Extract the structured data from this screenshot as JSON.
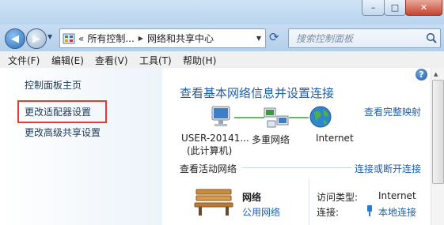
{
  "window": {
    "minimize": "–",
    "maximize": "□",
    "close": "✕"
  },
  "nav": {
    "back": "◀",
    "forward": "▶",
    "breadcrumb_prefix": "«",
    "breadcrumb_1": "所有控制...",
    "breadcrumb_sep": "▶",
    "breadcrumb_2": "网络和共享中心",
    "dropdown": "▼",
    "refresh": "⟳",
    "search_placeholder": "搜索控制面板",
    "search_icon": "search-icon"
  },
  "menu": [
    "文件(F)",
    "编辑(E)",
    "查看(V)",
    "工具(T)",
    "帮助(H)"
  ],
  "sidebar": {
    "home": "控制面板主页",
    "adapter": "更改适配器设置",
    "sharing": "更改高级共享设置"
  },
  "main": {
    "title": "查看基本网络信息并设置连接",
    "full_map": "查看完整映射",
    "help": "?",
    "map": [
      {
        "label": "USER-20141...",
        "sub": "(此计算机)"
      },
      {
        "label": "多重网络",
        "sub": ""
      },
      {
        "label": "Internet",
        "sub": ""
      }
    ],
    "active_header": "查看活动网络",
    "connect_link": "连接或断开连接",
    "network_name": "网络",
    "network_type": "公用网络",
    "access_type_label": "访问类型:",
    "access_type_value": "Internet",
    "connection_label": "连接:",
    "connection_value": "本地连接"
  },
  "colors": {
    "link": "#1f5fad",
    "heading": "#1e5fa6",
    "highlight": "#e33b2e"
  }
}
